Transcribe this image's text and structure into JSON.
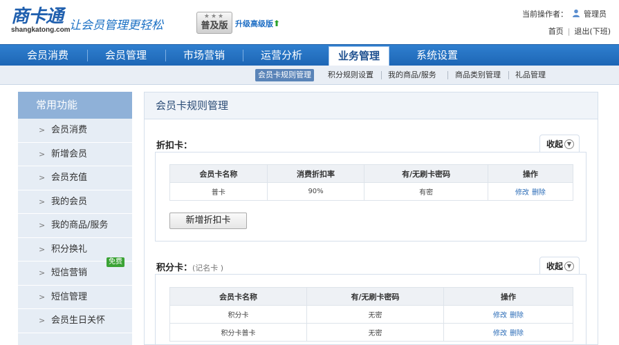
{
  "header": {
    "logo_main": "商卡通",
    "logo_sub": "shangkatong.com",
    "slogan": "让会员管理更轻松",
    "edition_stars": "★★★",
    "edition_label": "普及版",
    "upgrade_label": "升级高级版",
    "operator_label": "当前操作者：",
    "operator_name": "管理员",
    "home_link": "首页",
    "logout_link": "退出(下班)"
  },
  "nav": {
    "items": [
      "会员消费",
      "会员管理",
      "市场营销",
      "运营分析",
      "业务管理",
      "系统设置"
    ],
    "active": "业务管理"
  },
  "subnav": {
    "items": [
      "会员卡规则管理",
      "积分规则设置",
      "我的商品/服务",
      "商品类别管理",
      "礼品管理"
    ],
    "active": "会员卡规则管理"
  },
  "sidebar": {
    "title": "常用功能",
    "items": [
      "会员消费",
      "新增会员",
      "会员充值",
      "我的会员",
      "我的商品/服务",
      "积分换礼",
      "短信营销",
      "短信管理",
      "会员生日关怀"
    ],
    "badge": "免费"
  },
  "content": {
    "title": "会员卡规则管理",
    "discount_section": {
      "title": "折扣卡：",
      "collapse_label": "收起",
      "headers": [
        "会员卡名称",
        "消费折扣率",
        "有/无刷卡密码",
        "操作"
      ],
      "rows": [
        {
          "name": "普卡",
          "rate": "90%",
          "password": "有密",
          "edit": "修改",
          "delete": "删除"
        }
      ],
      "add_button": "新增折扣卡"
    },
    "points_section": {
      "title": "积分卡：",
      "note": "(记名卡 )",
      "collapse_label": "收起",
      "headers": [
        "会员卡名称",
        "有/无刷卡密码",
        "操作"
      ],
      "rows": [
        {
          "name": "积分卡",
          "password": "无密",
          "edit": "修改",
          "delete": "删除"
        },
        {
          "name": "积分卡普卡",
          "password": "无密",
          "edit": "修改",
          "delete": "删除"
        }
      ]
    }
  },
  "colors": {
    "nav_blue": "#1d66b5",
    "sidebar_head": "#8fb1d8",
    "link_blue": "#2b6cb7",
    "badge_green": "#3ba335"
  }
}
